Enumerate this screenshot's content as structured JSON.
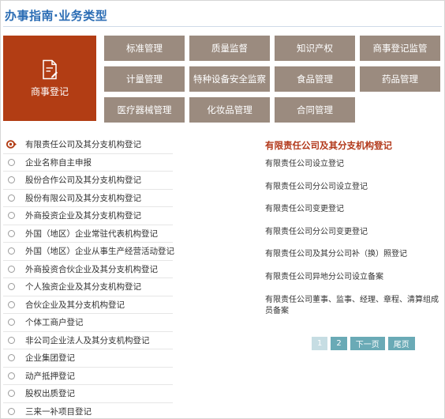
{
  "header": {
    "title": "办事指南·业务类型"
  },
  "active_category": {
    "label": "商事登记",
    "icon": "document-edit-icon"
  },
  "categories": [
    "标准管理",
    "质量监督",
    "知识产权",
    "商事登记监管",
    "计量管理",
    "特种设备安全监察",
    "食品管理",
    "药品管理",
    "医疗器械管理",
    "化妆品管理",
    "合同管理"
  ],
  "sidebar": {
    "items": [
      "有限责任公司及其分支机构登记",
      "企业名称自主申报",
      "股份合作公司及其分支机构登记",
      "股份有限公司及其分支机构登记",
      "外商投资企业及其分支机构登记",
      "外国（地区）企业常驻代表机构登记",
      "外国（地区）企业从事生产经营活动登记",
      "外商投资合伙企业及其分支机构登记",
      "个人独资企业及其分支机构登记",
      "合伙企业及其分支机构登记",
      "个体工商户登记",
      "非公司企业法人及其分支机构登记",
      "企业集团登记",
      "动产抵押登记",
      "股权出质登记",
      "三来一补项目登记"
    ],
    "active_index": 0
  },
  "main": {
    "title": "有限责任公司及其分支机构登记",
    "links": [
      "有限责任公司设立登记",
      "有限责任公司分公司设立登记",
      "有限责任公司变更登记",
      "有限责任公司分公司变更登记",
      "有限责任公司及其分公司补（换）照登记",
      "有限责任公司异地分公司设立备案",
      "有限责任公司董事、监事、经理、章程、清算组成员备案"
    ]
  },
  "pagination": {
    "pages": [
      "1",
      "2"
    ],
    "current": "1",
    "next_label": "下一页",
    "last_label": "尾页"
  },
  "colors": {
    "title_blue": "#2a6cb4",
    "active_red": "#b23d14",
    "category_gray": "#9b8b7f",
    "pager_teal": "#6aaab6",
    "pager_current": "#c6dde3"
  }
}
